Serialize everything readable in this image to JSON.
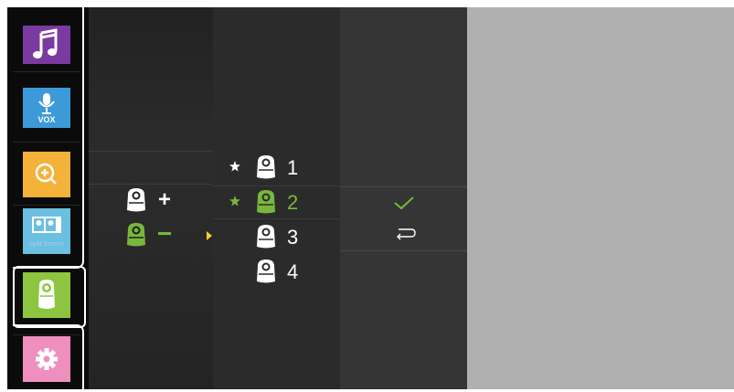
{
  "sidebar": {
    "items": [
      {
        "name": "music",
        "color": "#7b3aa0",
        "icon": "music-note-icon"
      },
      {
        "name": "vox",
        "color": "#3d9ad8",
        "icon": "microphone-icon",
        "label": "VOX"
      },
      {
        "name": "zoom",
        "color": "#f4b23a",
        "icon": "zoom-in-icon"
      },
      {
        "name": "split-screen",
        "color": "#6bbfe0",
        "icon": "split-screen-icon",
        "label": "Split Screen"
      },
      {
        "name": "camera",
        "color": "#8dc540",
        "icon": "camera-icon"
      },
      {
        "name": "settings",
        "color": "#ef8fbd",
        "icon": "gear-icon"
      }
    ]
  },
  "add_remove": {
    "add_symbol": "+",
    "remove_symbol": "−"
  },
  "cameras": [
    {
      "number": "1",
      "star": true,
      "active": false
    },
    {
      "number": "2",
      "star": true,
      "active": true
    },
    {
      "number": "3",
      "star": false,
      "active": false
    },
    {
      "number": "4",
      "star": false,
      "active": false
    }
  ],
  "colors": {
    "accent_green": "#77b83c",
    "pointer_yellow": "#f4d21f"
  }
}
